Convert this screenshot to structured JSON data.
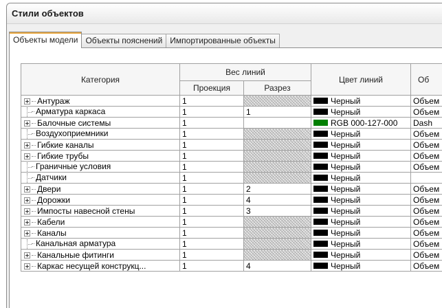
{
  "window": {
    "title": "Стили объектов"
  },
  "tabs": [
    {
      "label": "Объекты модели",
      "active": true
    },
    {
      "label": "Объекты пояснений",
      "active": false
    },
    {
      "label": "Импортированные объекты",
      "active": false
    }
  ],
  "table": {
    "headers": {
      "category": "Категория",
      "line_weight": "Вес линий",
      "projection": "Проекция",
      "cut": "Разрез",
      "line_color": "Цвет линий",
      "pattern": "Об"
    },
    "rows": [
      {
        "category": "Антураж",
        "expandable": true,
        "projection": "1",
        "cut": "",
        "cut_hatched": true,
        "color_name": "Черный",
        "color_hex": "#000000",
        "pattern": "Объем"
      },
      {
        "category": "Арматура каркаса",
        "expandable": false,
        "projection": "1",
        "cut": "1",
        "cut_hatched": false,
        "color_name": "Черный",
        "color_hex": "#000000",
        "pattern": "Объем"
      },
      {
        "category": "Балочные системы",
        "expandable": true,
        "projection": "1",
        "cut": "",
        "cut_hatched": false,
        "color_name": "RGB 000-127-000",
        "color_hex": "#007f00",
        "pattern": "Dash"
      },
      {
        "category": "Воздухоприемники",
        "expandable": false,
        "projection": "1",
        "cut": "",
        "cut_hatched": true,
        "color_name": "Черный",
        "color_hex": "#000000",
        "pattern": "Объем"
      },
      {
        "category": "Гибкие каналы",
        "expandable": true,
        "projection": "1",
        "cut": "",
        "cut_hatched": true,
        "color_name": "Черный",
        "color_hex": "#000000",
        "pattern": "Объем"
      },
      {
        "category": "Гибкие трубы",
        "expandable": true,
        "projection": "1",
        "cut": "",
        "cut_hatched": true,
        "color_name": "Черный",
        "color_hex": "#000000",
        "pattern": "Объем"
      },
      {
        "category": "Граничные условия",
        "expandable": false,
        "projection": "1",
        "cut": "",
        "cut_hatched": true,
        "color_name": "Черный",
        "color_hex": "#000000",
        "pattern": "Объем"
      },
      {
        "category": "Датчики",
        "expandable": false,
        "projection": "1",
        "cut": "",
        "cut_hatched": true,
        "color_name": "Черный",
        "color_hex": "#000000",
        "pattern": ""
      },
      {
        "category": "Двери",
        "expandable": true,
        "projection": "1",
        "cut": "2",
        "cut_hatched": false,
        "color_name": "Черный",
        "color_hex": "#000000",
        "pattern": "Объем"
      },
      {
        "category": "Дорожки",
        "expandable": true,
        "projection": "1",
        "cut": "4",
        "cut_hatched": false,
        "color_name": "Черный",
        "color_hex": "#000000",
        "pattern": "Объем"
      },
      {
        "category": "Импосты навесной стены",
        "expandable": true,
        "projection": "1",
        "cut": "3",
        "cut_hatched": false,
        "color_name": "Черный",
        "color_hex": "#000000",
        "pattern": "Объем"
      },
      {
        "category": "Кабели",
        "expandable": true,
        "projection": "1",
        "cut": "",
        "cut_hatched": true,
        "color_name": "Черный",
        "color_hex": "#000000",
        "pattern": "Объем"
      },
      {
        "category": "Каналы",
        "expandable": true,
        "projection": "1",
        "cut": "",
        "cut_hatched": true,
        "color_name": "Черный",
        "color_hex": "#000000",
        "pattern": "Объем"
      },
      {
        "category": "Канальная арматура",
        "expandable": false,
        "projection": "1",
        "cut": "",
        "cut_hatched": true,
        "color_name": "Черный",
        "color_hex": "#000000",
        "pattern": "Объем"
      },
      {
        "category": "Канальные фитинги",
        "expandable": true,
        "projection": "1",
        "cut": "",
        "cut_hatched": true,
        "color_name": "Черный",
        "color_hex": "#000000",
        "pattern": "Объем"
      },
      {
        "category": "Каркас несущей конструкц...",
        "expandable": true,
        "projection": "1",
        "cut": "4",
        "cut_hatched": false,
        "color_name": "Черный",
        "color_hex": "#000000",
        "pattern": "Объем"
      }
    ]
  }
}
